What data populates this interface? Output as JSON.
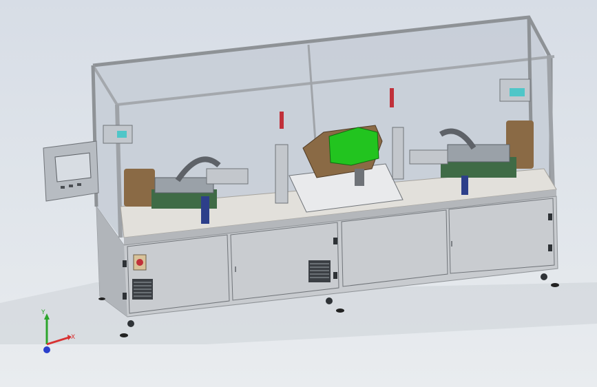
{
  "viewport": {
    "background_top": "#d7dde6",
    "background_bottom": "#e9ecef"
  },
  "machine": {
    "frame_color": "#b9bdc3",
    "glass_color": "#c8cfd8",
    "table_top_color": "#e3e1dc",
    "cabinet_color": "#c9ccd0",
    "green_part_color": "#22c41f",
    "bronze_part_color": "#8a6a45",
    "red_handle_color": "#c0303a",
    "hmi_screen_color": "#d8dde3"
  },
  "triad": {
    "x_label": "X",
    "y_label": "Y",
    "x_color": "#d83232",
    "y_color": "#2ca52c",
    "z_color": "#2a3fcc"
  },
  "icons": [
    "coordinate-triad-icon",
    "emergency-stop-icon",
    "vent-grille-icon",
    "caster-wheel-icon"
  ]
}
